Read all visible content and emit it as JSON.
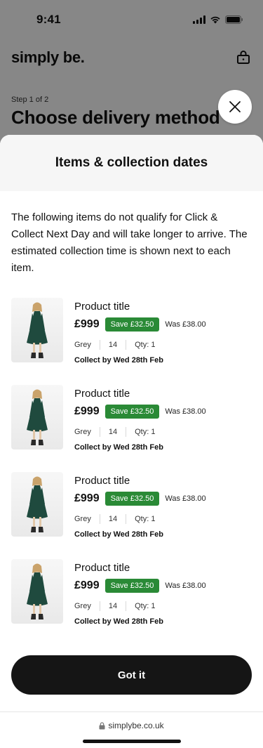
{
  "status_bar": {
    "time": "9:41"
  },
  "header": {
    "logo": "simply be."
  },
  "background_page": {
    "step": "Step 1 of 2",
    "title": "Choose delivery method"
  },
  "sheet": {
    "title": "Items & collection dates",
    "intro": "The following items do not qualify for Click & Collect Next Day and will take longer to arrive. The estimated collection time is shown next to each item.",
    "items": [
      {
        "title": "Product title",
        "price": "£999",
        "save": "Save £32.50",
        "was": "Was £38.00",
        "colour": "Grey",
        "size": "14",
        "qty": "Qty: 1",
        "collect": "Collect by Wed 28th Feb"
      },
      {
        "title": "Product title",
        "price": "£999",
        "save": "Save £32.50",
        "was": "Was £38.00",
        "colour": "Grey",
        "size": "14",
        "qty": "Qty: 1",
        "collect": "Collect by Wed 28th Feb"
      },
      {
        "title": "Product title",
        "price": "£999",
        "save": "Save £32.50",
        "was": "Was £38.00",
        "colour": "Grey",
        "size": "14",
        "qty": "Qty: 1",
        "collect": "Collect by Wed 28th Feb"
      },
      {
        "title": "Product title",
        "price": "£999",
        "save": "Save £32.50",
        "was": "Was £38.00",
        "colour": "Grey",
        "size": "14",
        "qty": "Qty: 1",
        "collect": "Collect by Wed 28th Feb"
      }
    ],
    "cta_label": "Got it"
  },
  "browser": {
    "url": "simplybe.co.uk"
  },
  "colors": {
    "save_badge": "#2a8a36",
    "cta": "#151515",
    "dress": "#1f4a3e"
  },
  "icons": [
    "signal-icon",
    "wifi-icon",
    "battery-icon",
    "shopping-bag-icon",
    "close-icon",
    "lock-icon"
  ]
}
